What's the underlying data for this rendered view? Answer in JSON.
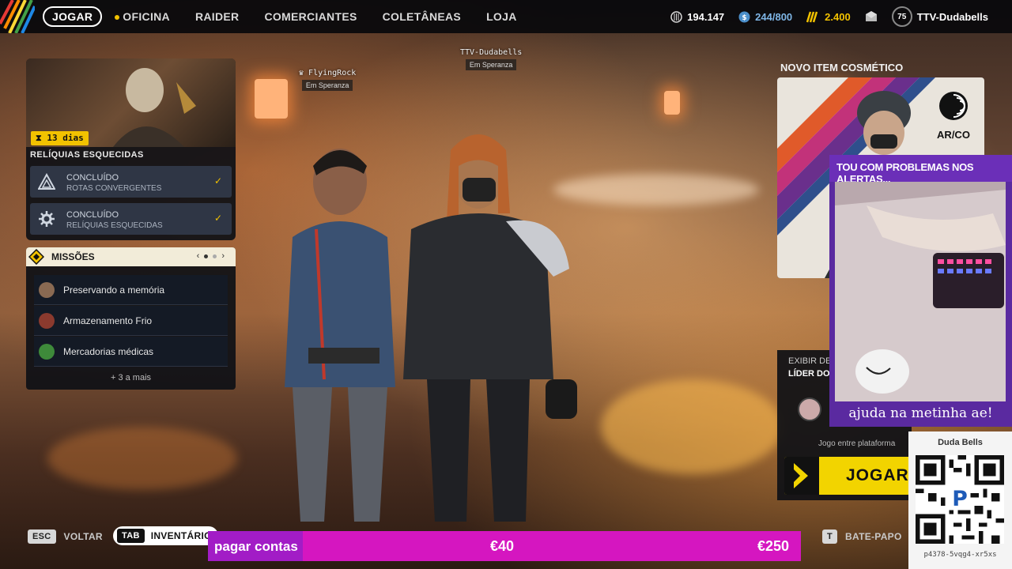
{
  "nav": {
    "items": [
      {
        "label": "JOGAR",
        "active": true
      },
      {
        "label": "OFICINA",
        "dot": true
      },
      {
        "label": "RAIDER"
      },
      {
        "label": "COMERCIANTES"
      },
      {
        "label": "COLETÂNEAS"
      },
      {
        "label": "LOJA"
      }
    ]
  },
  "stats": {
    "coins": "194.147",
    "capacity": "244/800",
    "credits": "2.400",
    "level": "75",
    "username": "TTV-Dudabells"
  },
  "event": {
    "days": "13 dias",
    "title": "RELÍQUIAS ESQUECIDAS",
    "tasks": [
      {
        "status": "CONCLUÍDO",
        "name": "ROTAS CONVERGENTES",
        "icon": "triangle-icon"
      },
      {
        "status": "CONCLUÍDO",
        "name": "RELÍQUIAS ESQUECIDAS",
        "icon": "gear-icon"
      }
    ]
  },
  "missions": {
    "title": "MISSÕES",
    "items": [
      {
        "label": "Preservando a memória"
      },
      {
        "label": "Armazenamento Frio"
      },
      {
        "label": "Mercadorias médicas"
      }
    ],
    "more": "+ 3 a mais"
  },
  "players": [
    {
      "name": "FlyingRock",
      "location": "Em Speranza"
    },
    {
      "name": "TTV-Dudabells",
      "location": "Em Speranza"
    }
  ],
  "cosmetic": {
    "title": "NOVO ITEM COSMÉTICO",
    "brand": "AR/CO"
  },
  "leader": {
    "line1": "EXIBIR DE",
    "line2": "LÍDER DO",
    "crossplay": "Jogo entre plataforma",
    "play": "JOGAR"
  },
  "overlay": {
    "cam_title": "TOU COM PROBLEMAS NOS ALERTAS...",
    "cam_caption": "ajuda na metinha ae!",
    "qr_title": "Duda Bells",
    "qr_code": "p4378-5vqg4-xr5xs"
  },
  "hints": {
    "esc_key": "ESC",
    "esc_label": "VOLTAR",
    "tab_key": "TAB",
    "tab_label": "INVENTÁRIO",
    "t_key": "T",
    "t_label": "BATE-PAPO"
  },
  "donation": {
    "label": "pagar contas",
    "current": "€40",
    "goal": "€250"
  },
  "colors": {
    "accent": "#f2c200",
    "donation": "#d516c0",
    "cam_border": "#6b2fb8"
  }
}
